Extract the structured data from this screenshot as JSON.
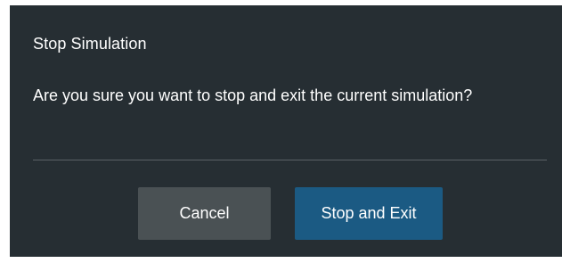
{
  "dialog": {
    "title": "Stop Simulation",
    "message": "Are you sure you want to stop and exit the current simulation?",
    "buttons": {
      "cancel_label": "Cancel",
      "confirm_label": "Stop and Exit"
    }
  },
  "colors": {
    "dialog_background": "#262e33",
    "cancel_button": "#4a5154",
    "confirm_button": "#1b5a83",
    "text": "#ffffff",
    "divider": "#5a6166"
  }
}
